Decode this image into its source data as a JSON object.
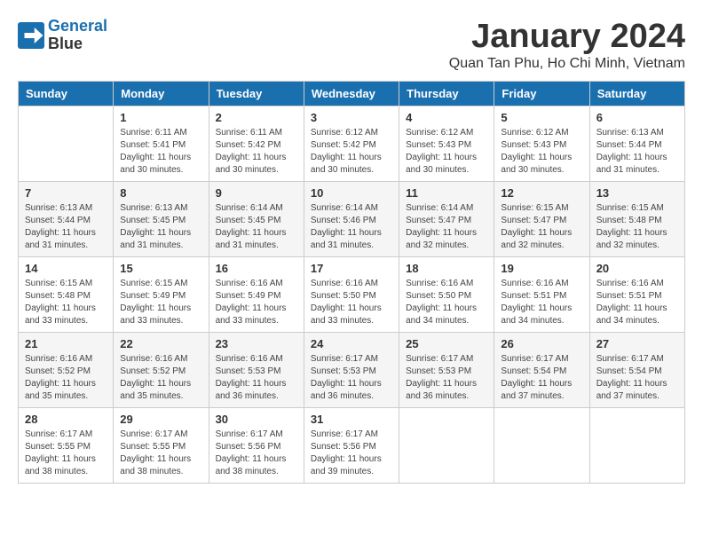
{
  "header": {
    "logo_line1": "General",
    "logo_line2": "Blue",
    "month": "January 2024",
    "location": "Quan Tan Phu, Ho Chi Minh, Vietnam"
  },
  "days_of_week": [
    "Sunday",
    "Monday",
    "Tuesday",
    "Wednesday",
    "Thursday",
    "Friday",
    "Saturday"
  ],
  "weeks": [
    [
      {
        "day": "",
        "info": ""
      },
      {
        "day": "1",
        "info": "Sunrise: 6:11 AM\nSunset: 5:41 PM\nDaylight: 11 hours\nand 30 minutes."
      },
      {
        "day": "2",
        "info": "Sunrise: 6:11 AM\nSunset: 5:42 PM\nDaylight: 11 hours\nand 30 minutes."
      },
      {
        "day": "3",
        "info": "Sunrise: 6:12 AM\nSunset: 5:42 PM\nDaylight: 11 hours\nand 30 minutes."
      },
      {
        "day": "4",
        "info": "Sunrise: 6:12 AM\nSunset: 5:43 PM\nDaylight: 11 hours\nand 30 minutes."
      },
      {
        "day": "5",
        "info": "Sunrise: 6:12 AM\nSunset: 5:43 PM\nDaylight: 11 hours\nand 30 minutes."
      },
      {
        "day": "6",
        "info": "Sunrise: 6:13 AM\nSunset: 5:44 PM\nDaylight: 11 hours\nand 31 minutes."
      }
    ],
    [
      {
        "day": "7",
        "info": "Sunrise: 6:13 AM\nSunset: 5:44 PM\nDaylight: 11 hours\nand 31 minutes."
      },
      {
        "day": "8",
        "info": "Sunrise: 6:13 AM\nSunset: 5:45 PM\nDaylight: 11 hours\nand 31 minutes."
      },
      {
        "day": "9",
        "info": "Sunrise: 6:14 AM\nSunset: 5:45 PM\nDaylight: 11 hours\nand 31 minutes."
      },
      {
        "day": "10",
        "info": "Sunrise: 6:14 AM\nSunset: 5:46 PM\nDaylight: 11 hours\nand 31 minutes."
      },
      {
        "day": "11",
        "info": "Sunrise: 6:14 AM\nSunset: 5:47 PM\nDaylight: 11 hours\nand 32 minutes."
      },
      {
        "day": "12",
        "info": "Sunrise: 6:15 AM\nSunset: 5:47 PM\nDaylight: 11 hours\nand 32 minutes."
      },
      {
        "day": "13",
        "info": "Sunrise: 6:15 AM\nSunset: 5:48 PM\nDaylight: 11 hours\nand 32 minutes."
      }
    ],
    [
      {
        "day": "14",
        "info": "Sunrise: 6:15 AM\nSunset: 5:48 PM\nDaylight: 11 hours\nand 33 minutes."
      },
      {
        "day": "15",
        "info": "Sunrise: 6:15 AM\nSunset: 5:49 PM\nDaylight: 11 hours\nand 33 minutes."
      },
      {
        "day": "16",
        "info": "Sunrise: 6:16 AM\nSunset: 5:49 PM\nDaylight: 11 hours\nand 33 minutes."
      },
      {
        "day": "17",
        "info": "Sunrise: 6:16 AM\nSunset: 5:50 PM\nDaylight: 11 hours\nand 33 minutes."
      },
      {
        "day": "18",
        "info": "Sunrise: 6:16 AM\nSunset: 5:50 PM\nDaylight: 11 hours\nand 34 minutes."
      },
      {
        "day": "19",
        "info": "Sunrise: 6:16 AM\nSunset: 5:51 PM\nDaylight: 11 hours\nand 34 minutes."
      },
      {
        "day": "20",
        "info": "Sunrise: 6:16 AM\nSunset: 5:51 PM\nDaylight: 11 hours\nand 34 minutes."
      }
    ],
    [
      {
        "day": "21",
        "info": "Sunrise: 6:16 AM\nSunset: 5:52 PM\nDaylight: 11 hours\nand 35 minutes."
      },
      {
        "day": "22",
        "info": "Sunrise: 6:16 AM\nSunset: 5:52 PM\nDaylight: 11 hours\nand 35 minutes."
      },
      {
        "day": "23",
        "info": "Sunrise: 6:16 AM\nSunset: 5:53 PM\nDaylight: 11 hours\nand 36 minutes."
      },
      {
        "day": "24",
        "info": "Sunrise: 6:17 AM\nSunset: 5:53 PM\nDaylight: 11 hours\nand 36 minutes."
      },
      {
        "day": "25",
        "info": "Sunrise: 6:17 AM\nSunset: 5:53 PM\nDaylight: 11 hours\nand 36 minutes."
      },
      {
        "day": "26",
        "info": "Sunrise: 6:17 AM\nSunset: 5:54 PM\nDaylight: 11 hours\nand 37 minutes."
      },
      {
        "day": "27",
        "info": "Sunrise: 6:17 AM\nSunset: 5:54 PM\nDaylight: 11 hours\nand 37 minutes."
      }
    ],
    [
      {
        "day": "28",
        "info": "Sunrise: 6:17 AM\nSunset: 5:55 PM\nDaylight: 11 hours\nand 38 minutes."
      },
      {
        "day": "29",
        "info": "Sunrise: 6:17 AM\nSunset: 5:55 PM\nDaylight: 11 hours\nand 38 minutes."
      },
      {
        "day": "30",
        "info": "Sunrise: 6:17 AM\nSunset: 5:56 PM\nDaylight: 11 hours\nand 38 minutes."
      },
      {
        "day": "31",
        "info": "Sunrise: 6:17 AM\nSunset: 5:56 PM\nDaylight: 11 hours\nand 39 minutes."
      },
      {
        "day": "",
        "info": ""
      },
      {
        "day": "",
        "info": ""
      },
      {
        "day": "",
        "info": ""
      }
    ]
  ]
}
